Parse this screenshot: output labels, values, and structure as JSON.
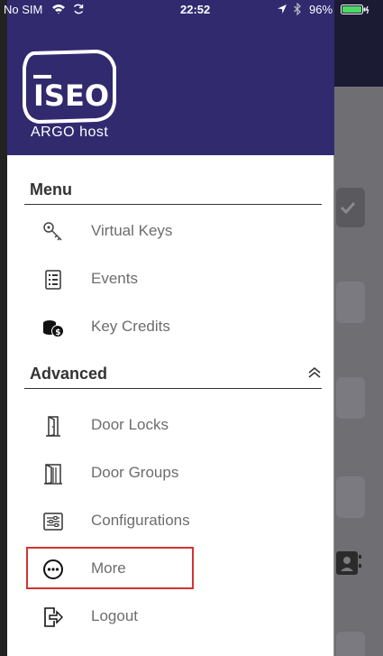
{
  "status_bar": {
    "carrier": "No SIM",
    "time": "22:52",
    "battery": "96%"
  },
  "drawer": {
    "brand_logo": "ISEO",
    "app_name": "ARGO host",
    "menu_section": {
      "label": "Menu",
      "items": [
        {
          "label": "Virtual Keys",
          "icon": "key-icon"
        },
        {
          "label": "Events",
          "icon": "document-list-icon"
        },
        {
          "label": "Key Credits",
          "icon": "coins-icon"
        }
      ]
    },
    "advanced_section": {
      "label": "Advanced",
      "items": [
        {
          "label": "Door Locks",
          "icon": "door-icon"
        },
        {
          "label": "Door Groups",
          "icon": "double-door-icon"
        },
        {
          "label": "Configurations",
          "icon": "sliders-icon"
        },
        {
          "label": "More",
          "icon": "more-dots-icon"
        },
        {
          "label": "Logout",
          "icon": "logout-icon"
        }
      ]
    }
  },
  "colors": {
    "header_bg": "#312a6f",
    "highlight": "#d33333"
  }
}
